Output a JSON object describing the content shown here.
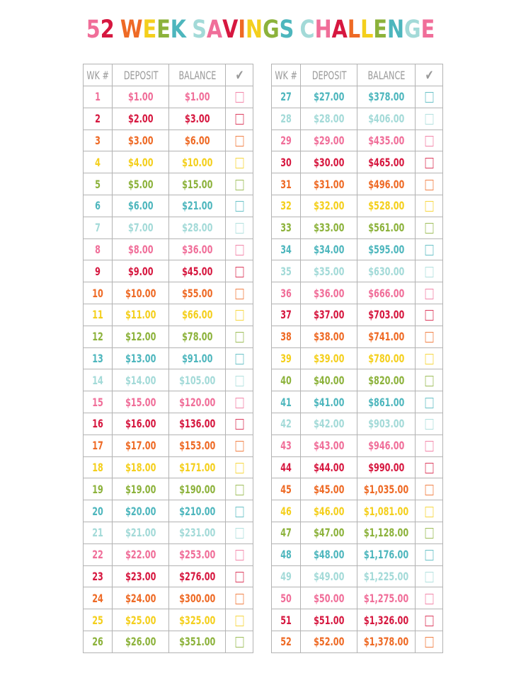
{
  "colors": {
    "pink": "#f06e99",
    "red": "#d6173f",
    "orange": "#ee6a25",
    "yellow": "#f4cf1c",
    "green": "#8cb23b",
    "teal": "#4db6bd",
    "lightteal": "#a3dad8",
    "header_gray": "#9a9a9a",
    "grid": "#b3b3b3"
  },
  "title": {
    "text": "52 WEEK SAVINGS CHALLENGE",
    "letter_color_cycle": [
      "pink",
      "red",
      "orange",
      "yellow",
      "green",
      "teal",
      "lightteal"
    ]
  },
  "table": {
    "headers": [
      "WK #",
      "DEPOSIT",
      "BALANCE",
      "✔"
    ],
    "row_color_cycle": [
      "pink",
      "red",
      "orange",
      "yellow",
      "green",
      "teal",
      "lightteal"
    ],
    "left_rows": [
      {
        "wk": "1",
        "deposit": "$1.00",
        "balance": "$1.00"
      },
      {
        "wk": "2",
        "deposit": "$2.00",
        "balance": "$3.00"
      },
      {
        "wk": "3",
        "deposit": "$3.00",
        "balance": "$6.00"
      },
      {
        "wk": "4",
        "deposit": "$4.00",
        "balance": "$10.00"
      },
      {
        "wk": "5",
        "deposit": "$5.00",
        "balance": "$15.00"
      },
      {
        "wk": "6",
        "deposit": "$6.00",
        "balance": "$21.00"
      },
      {
        "wk": "7",
        "deposit": "$7.00",
        "balance": "$28.00"
      },
      {
        "wk": "8",
        "deposit": "$8.00",
        "balance": "$36.00"
      },
      {
        "wk": "9",
        "deposit": "$9.00",
        "balance": "$45.00"
      },
      {
        "wk": "10",
        "deposit": "$10.00",
        "balance": "$55.00"
      },
      {
        "wk": "11",
        "deposit": "$11.00",
        "balance": "$66.00"
      },
      {
        "wk": "12",
        "deposit": "$12.00",
        "balance": "$78.00"
      },
      {
        "wk": "13",
        "deposit": "$13.00",
        "balance": "$91.00"
      },
      {
        "wk": "14",
        "deposit": "$14.00",
        "balance": "$105.00"
      },
      {
        "wk": "15",
        "deposit": "$15.00",
        "balance": "$120.00"
      },
      {
        "wk": "16",
        "deposit": "$16.00",
        "balance": "$136.00"
      },
      {
        "wk": "17",
        "deposit": "$17.00",
        "balance": "$153.00"
      },
      {
        "wk": "18",
        "deposit": "$18.00",
        "balance": "$171.00"
      },
      {
        "wk": "19",
        "deposit": "$19.00",
        "balance": "$190.00"
      },
      {
        "wk": "20",
        "deposit": "$20.00",
        "balance": "$210.00"
      },
      {
        "wk": "21",
        "deposit": "$21.00",
        "balance": "$231.00"
      },
      {
        "wk": "22",
        "deposit": "$22.00",
        "balance": "$253.00"
      },
      {
        "wk": "23",
        "deposit": "$23.00",
        "balance": "$276.00"
      },
      {
        "wk": "24",
        "deposit": "$24.00",
        "balance": "$300.00"
      },
      {
        "wk": "25",
        "deposit": "$25.00",
        "balance": "$325.00"
      },
      {
        "wk": "26",
        "deposit": "$26.00",
        "balance": "$351.00"
      }
    ],
    "right_rows": [
      {
        "wk": "27",
        "deposit": "$27.00",
        "balance": "$378.00"
      },
      {
        "wk": "28",
        "deposit": "$28.00",
        "balance": "$406.00"
      },
      {
        "wk": "29",
        "deposit": "$29.00",
        "balance": "$435.00"
      },
      {
        "wk": "30",
        "deposit": "$30.00",
        "balance": "$465.00"
      },
      {
        "wk": "31",
        "deposit": "$31.00",
        "balance": "$496.00"
      },
      {
        "wk": "32",
        "deposit": "$32.00",
        "balance": "$528.00"
      },
      {
        "wk": "33",
        "deposit": "$33.00",
        "balance": "$561.00"
      },
      {
        "wk": "34",
        "deposit": "$34.00",
        "balance": "$595.00"
      },
      {
        "wk": "35",
        "deposit": "$35.00",
        "balance": "$630.00"
      },
      {
        "wk": "36",
        "deposit": "$36.00",
        "balance": "$666.00"
      },
      {
        "wk": "37",
        "deposit": "$37.00",
        "balance": "$703.00"
      },
      {
        "wk": "38",
        "deposit": "$38.00",
        "balance": "$741.00"
      },
      {
        "wk": "39",
        "deposit": "$39.00",
        "balance": "$780.00"
      },
      {
        "wk": "40",
        "deposit": "$40.00",
        "balance": "$820.00"
      },
      {
        "wk": "41",
        "deposit": "$41.00",
        "balance": "$861.00"
      },
      {
        "wk": "42",
        "deposit": "$42.00",
        "balance": "$903.00"
      },
      {
        "wk": "43",
        "deposit": "$43.00",
        "balance": "$946.00"
      },
      {
        "wk": "44",
        "deposit": "$44.00",
        "balance": "$990.00"
      },
      {
        "wk": "45",
        "deposit": "$45.00",
        "balance": "$1,035.00"
      },
      {
        "wk": "46",
        "deposit": "$46.00",
        "balance": "$1,081.00"
      },
      {
        "wk": "47",
        "deposit": "$47.00",
        "balance": "$1,128.00"
      },
      {
        "wk": "48",
        "deposit": "$48.00",
        "balance": "$1,176.00"
      },
      {
        "wk": "49",
        "deposit": "$49.00",
        "balance": "$1,225.00"
      },
      {
        "wk": "50",
        "deposit": "$50.00",
        "balance": "$1,275.00"
      },
      {
        "wk": "51",
        "deposit": "$51.00",
        "balance": "$1,326.00"
      },
      {
        "wk": "52",
        "deposit": "$52.00",
        "balance": "$1,378.00"
      }
    ]
  }
}
